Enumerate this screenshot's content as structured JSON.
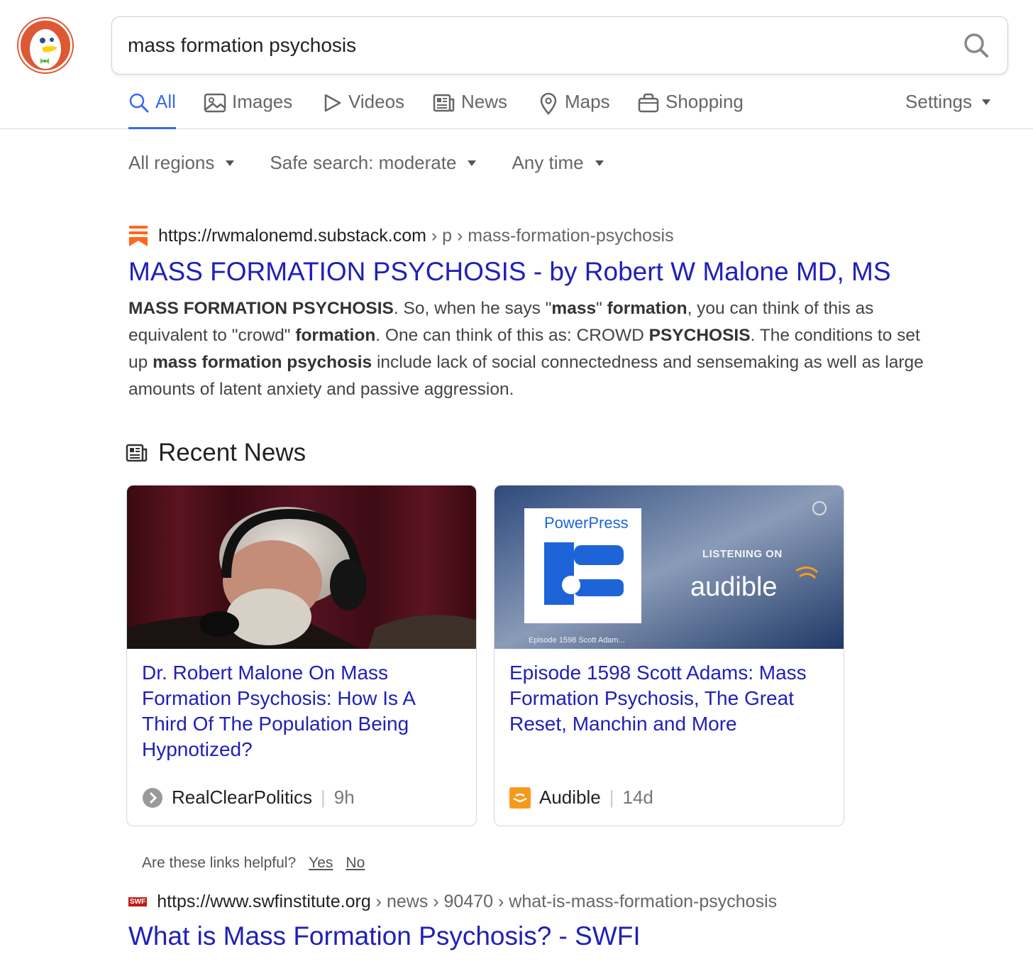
{
  "search": {
    "query": "mass formation psychosis"
  },
  "tabs": [
    {
      "label": "All",
      "active": true
    },
    {
      "label": "Images"
    },
    {
      "label": "Videos"
    },
    {
      "label": "News"
    },
    {
      "label": "Maps"
    },
    {
      "label": "Shopping"
    }
  ],
  "settings_label": "Settings",
  "filters": {
    "region": "All regions",
    "safe_search": "Safe search: moderate",
    "time": "Any time"
  },
  "result1": {
    "domain": "https://rwmalonemd.substack.com",
    "path": " › p › mass-formation-psychosis",
    "title": "MASS FORMATION PSYCHOSIS - by Robert W Malone MD, MS",
    "snippet": [
      {
        "t": "MASS FORMATION PSYCHOSIS",
        "b": true
      },
      {
        "t": ". So, when he says \"",
        "b": false
      },
      {
        "t": "mass",
        "b": true
      },
      {
        "t": "\" ",
        "b": false
      },
      {
        "t": "formation",
        "b": true
      },
      {
        "t": ", you can think of this as equivalent to \"crowd\" ",
        "b": false
      },
      {
        "t": "formation",
        "b": true
      },
      {
        "t": ". One can think of this as: CROWD ",
        "b": false
      },
      {
        "t": "PSYCHOSIS",
        "b": true
      },
      {
        "t": ". The conditions to set up ",
        "b": false
      },
      {
        "t": "mass formation psychosis",
        "b": true
      },
      {
        "t": " include lack of social connectedness and sensemaking as well as large amounts of latent anxiety and passive aggression.",
        "b": false
      }
    ]
  },
  "recent_news": {
    "heading": "Recent News",
    "cards": [
      {
        "title": "Dr. Robert Malone On Mass Formation Psychosis: How Is A Third Of The Population Being Hypnotized?",
        "source": "RealClearPolitics",
        "time": "9h"
      },
      {
        "title": "Episode 1598 Scott Adams: Mass Formation Psychosis, The Great Reset, Manchin and More",
        "source": "Audible",
        "time": "14d",
        "thumb": {
          "brand": "PowerPress",
          "listening": "LISTENING ON",
          "service": "audible",
          "caption": "Episode 1598 Scott Adam..."
        }
      }
    ]
  },
  "helpful": {
    "question": "Are these links helpful?",
    "yes": "Yes",
    "no": "No"
  },
  "result2": {
    "favicon_text": "SWF",
    "domain": "https://www.swfinstitute.org",
    "path": " › news › 90470 › what-is-mass-formation-psychosis",
    "title": "What is Mass Formation Psychosis? - SWFI"
  },
  "colors": {
    "link": "#2020b8",
    "accent": "#3969ef",
    "brand": "#de5833",
    "substack": "#ff6719",
    "audible": "#f7991c"
  }
}
